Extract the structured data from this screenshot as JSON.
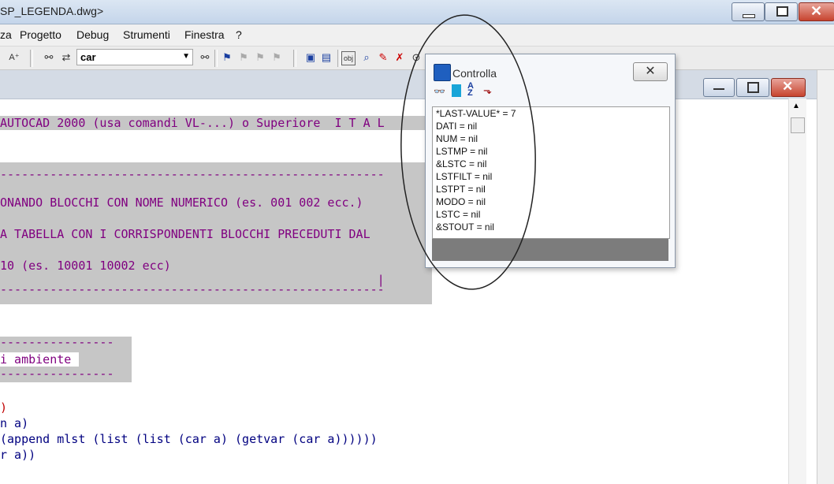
{
  "window": {
    "title": "SP_LEGENDA.dwg>",
    "buttons": [
      "minimize",
      "restore",
      "close"
    ]
  },
  "menu": [
    "za",
    "Progetto",
    "Debug",
    "Strumenti",
    "Finestra",
    "?"
  ],
  "toolbar": {
    "search_value": "car"
  },
  "editor": {
    "lines": [
      {
        "text": "AUTOCAD 2000 (usa comandi VL-...) o Superiore  I T A L",
        "hl": true
      },
      {
        "text": "",
        "hl": false
      },
      {
        "text": "",
        "hl": false
      },
      {
        "text": "------------------------------------------------------",
        "hl": true
      },
      {
        "text": "",
        "hl": true
      },
      {
        "text": "ONANDO BLOCCHI CON NOME NUMERICO (es. 001 002 ecc.)",
        "hl": true
      },
      {
        "text": "",
        "hl": true
      },
      {
        "text": "A TABELLA CON I CORRISPONDENTI BLOCCHI PRECEDUTI DAL",
        "hl": true
      },
      {
        "text": "",
        "hl": true
      },
      {
        "text": "10 (es. 10001 10002 ecc)",
        "hl": true
      },
      {
        "text": "                                                     |",
        "hl": true
      },
      {
        "text": "------------------------------------------------------",
        "hl": true
      }
    ],
    "block2": [
      "----------------",
      "i ambiente",
      "----------------"
    ],
    "code_lines": [
      ")",
      "n a)",
      "(append mlst (list (list (car a) (getvar (car a))))))",
      "r a))"
    ]
  },
  "dialog": {
    "title": "Controlla",
    "close_label": "✕",
    "items": [
      "*LAST-VALUE* = 7",
      "DATI = nil",
      "NUM = nil",
      "LSTMP = nil",
      "&LSTC = nil",
      "LSTFILT = nil",
      "LSTPT = nil",
      "MODO = nil",
      "LSTC = nil",
      "&STOUT = nil"
    ]
  }
}
